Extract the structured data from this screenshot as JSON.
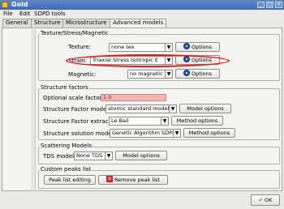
{
  "window": {
    "title": "Gold"
  },
  "menubar": {
    "items": [
      "File",
      "Edit",
      "SDPD tools"
    ]
  },
  "tabs": [
    "General",
    "Structure",
    "Microstructure",
    "Advanced models"
  ],
  "texture": {
    "title": "Texture/Stress/Magnetic",
    "texture_label": "Texture:",
    "texture_value": "none tex",
    "strain_label": "Strain:",
    "strain_value": "Triaxial Stress Isotropic E",
    "magnetic_label": "Magnetic:",
    "magnetic_value": "no magnetic",
    "options_label": "Options"
  },
  "structure": {
    "title": "Structure factors",
    "scale_label": "Optional scale factor:",
    "scale_value": "1.0",
    "model_label": "Structure Factor model:",
    "model_value": "atomic standard model",
    "model_btn": "Model options",
    "extractor_label": "Structure Factor extractor:",
    "extractor_value": "Le Bail",
    "extractor_btn": "Method options",
    "solution_label": "Structure solution model:",
    "solution_value": "Genetic Algorithm SDPD",
    "solution_btn": "Method options"
  },
  "scattering": {
    "title": "Scattering Models",
    "tds_label": "TDS model:",
    "tds_value": "None TDS",
    "tds_btn": "Model options"
  },
  "peaks": {
    "title": "Custom peaks list",
    "edit_btn": "Peak list editing",
    "remove_btn": "Remove peak list"
  },
  "footer": {
    "ok_label": "OK"
  },
  "colors": {
    "highlight": "#e01818",
    "titlebar": "#4a76bd",
    "scale_field": "#f2b4b4"
  }
}
